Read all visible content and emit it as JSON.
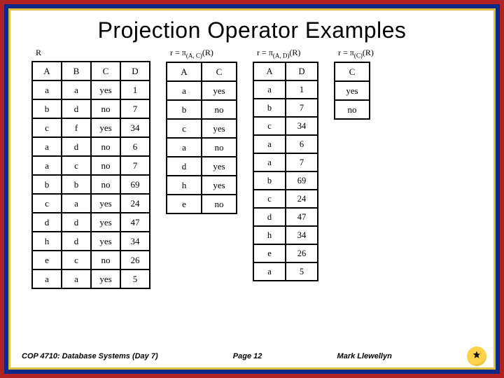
{
  "title": "Projection Operator Examples",
  "captions": {
    "R": "R",
    "AC": "r = π(A, C)(R)",
    "AD": "r = π(A, D)(R)",
    "C": "r = π(C)(R)"
  },
  "tables": {
    "R": {
      "headers": [
        "A",
        "B",
        "C",
        "D"
      ],
      "rows": [
        [
          "a",
          "a",
          "yes",
          "1"
        ],
        [
          "b",
          "d",
          "no",
          "7"
        ],
        [
          "c",
          "f",
          "yes",
          "34"
        ],
        [
          "a",
          "d",
          "no",
          "6"
        ],
        [
          "a",
          "c",
          "no",
          "7"
        ],
        [
          "b",
          "b",
          "no",
          "69"
        ],
        [
          "c",
          "a",
          "yes",
          "24"
        ],
        [
          "d",
          "d",
          "yes",
          "47"
        ],
        [
          "h",
          "d",
          "yes",
          "34"
        ],
        [
          "e",
          "c",
          "no",
          "26"
        ],
        [
          "a",
          "a",
          "yes",
          "5"
        ]
      ]
    },
    "AC": {
      "headers": [
        "A",
        "C"
      ],
      "rows": [
        [
          "a",
          "yes"
        ],
        [
          "b",
          "no"
        ],
        [
          "c",
          "yes"
        ],
        [
          "a",
          "no"
        ],
        [
          "d",
          "yes"
        ],
        [
          "h",
          "yes"
        ],
        [
          "e",
          "no"
        ]
      ]
    },
    "AD": {
      "headers": [
        "A",
        "D"
      ],
      "rows": [
        [
          "a",
          "1"
        ],
        [
          "b",
          "7"
        ],
        [
          "c",
          "34"
        ],
        [
          "a",
          "6"
        ],
        [
          "a",
          "7"
        ],
        [
          "b",
          "69"
        ],
        [
          "c",
          "24"
        ],
        [
          "d",
          "47"
        ],
        [
          "h",
          "34"
        ],
        [
          "e",
          "26"
        ],
        [
          "a",
          "5"
        ]
      ]
    },
    "C": {
      "headers": [
        "C"
      ],
      "rows": [
        [
          "yes"
        ],
        [
          "no"
        ]
      ]
    }
  },
  "footer": {
    "left": "COP 4710: Database Systems (Day 7)",
    "center": "Page 12",
    "right": "Mark Llewellyn"
  }
}
